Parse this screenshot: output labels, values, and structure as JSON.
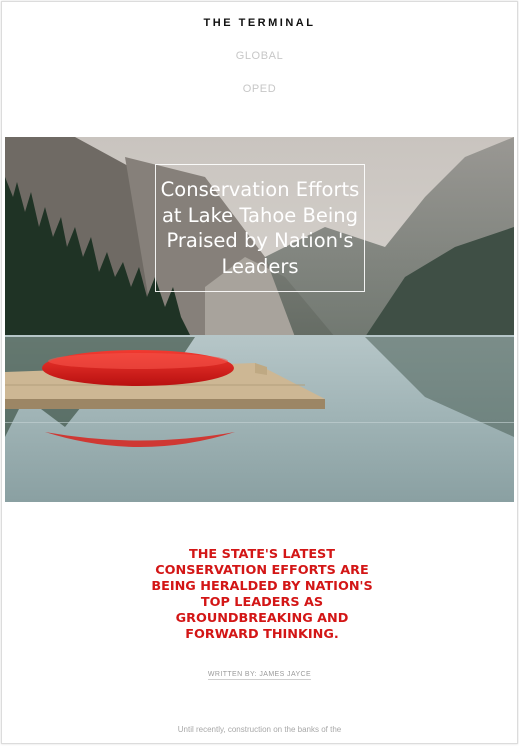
{
  "site": {
    "name": "THE TERMINAL"
  },
  "nav": {
    "items": [
      "GLOBAL",
      "OPED"
    ]
  },
  "article": {
    "title": "Conservation Efforts at Lake Tahoe Being Praised by Nation's Leaders",
    "subhead": "The state's latest conservation efforts are being heralded by nation's top leaders as groundbreaking and forward thinking.",
    "byline": "WRITTEN BY: JAMES JAYCE",
    "body_preview": "Until recently, construction on the banks of the"
  },
  "colors": {
    "accent": "#d31616"
  }
}
